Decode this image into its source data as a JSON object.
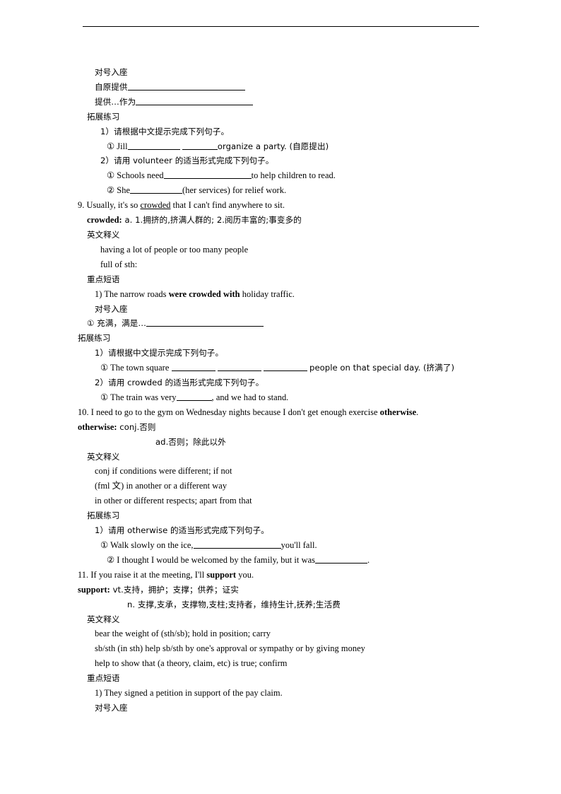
{
  "document": {
    "type": "english-vocabulary-worksheet",
    "header_rule": true,
    "lines": [
      {
        "id": "l1",
        "indent": 2,
        "script": "cn",
        "text": "对号入座"
      },
      {
        "id": "l2",
        "indent": 2,
        "script": "cn",
        "text": "① 自原提供",
        "blank": "xxl"
      },
      {
        "id": "l3",
        "indent": 2,
        "script": "cn",
        "text": "② 提供…作为",
        "blank": "xxl"
      },
      {
        "id": "l4",
        "indent": 1,
        "script": "cn",
        "text": "拓展练习"
      },
      {
        "id": "l5",
        "indent": 3,
        "script": "cn",
        "text": "1）请根据中文提示完成下列句子。"
      },
      {
        "id": "l6",
        "indent": 4,
        "script": "mixed",
        "text": "① Jill ________ ______organize a party. (自愿提出)"
      },
      {
        "id": "l7",
        "indent": 3,
        "script": "cn",
        "text": "2）请用 volunteer 的适当形式完成下列句子。"
      },
      {
        "id": "l8",
        "indent": 4,
        "script": "en",
        "text": "① Schools need ___________to help children to read."
      },
      {
        "id": "l9",
        "indent": 4,
        "script": "en",
        "text": "② She ________(her services) for relief work."
      },
      {
        "id": "l10",
        "indent": 0,
        "script": "en",
        "text": "9. Usually, it's so crowded that I can't find anywhere to sit."
      },
      {
        "id": "l11",
        "indent": 1,
        "script": "mixed",
        "text": "crowded: a. 1.拥挤的,挤满人群的; 2.阅历丰富的;事变多的"
      },
      {
        "id": "l12",
        "indent": 1,
        "script": "cn",
        "text": "英文释义"
      },
      {
        "id": "l13",
        "indent": 3,
        "script": "en",
        "text": "having a lot of people or too many people"
      },
      {
        "id": "l14",
        "indent": 3,
        "script": "en",
        "text": "full of sth:"
      },
      {
        "id": "l15",
        "indent": 1,
        "script": "cn",
        "text": "重点短语"
      },
      {
        "id": "l16",
        "indent": 2,
        "script": "en",
        "text": "1) The narrow roads were crowded with holiday traffic."
      },
      {
        "id": "l17",
        "indent": 2,
        "script": "cn",
        "text": "对号入座"
      },
      {
        "id": "l18",
        "indent": 1,
        "script": "cn",
        "text": "① 充满，满是…"
      },
      {
        "id": "l19",
        "indent": 0,
        "script": "cn",
        "text": "拓展练习"
      },
      {
        "id": "l20",
        "indent": 2,
        "script": "cn",
        "text": "1）请根据中文提示完成下列句子。"
      },
      {
        "id": "l21",
        "indent": 3,
        "script": "mixed",
        "text": "① The town square _____ _____ _____ people on that special day. (挤满了)"
      },
      {
        "id": "l22",
        "indent": 2,
        "script": "cn",
        "text": "2）请用 crowded 的适当形式完成下列句子。"
      },
      {
        "id": "l23",
        "indent": 3,
        "script": "en",
        "text": "① The train was very______, and we had to stand."
      },
      {
        "id": "l24",
        "indent": 0,
        "script": "en",
        "text": "10. I need to go to the gym on Wednesday nights because I don't get enough exercise otherwise."
      },
      {
        "id": "l25",
        "indent": 0,
        "script": "mixed",
        "text": "otherwise: conj.否则"
      },
      {
        "id": "l26",
        "indent": 8,
        "script": "cn",
        "text": "ad.否则；除此以外"
      },
      {
        "id": "l27",
        "indent": 1,
        "script": "cn",
        "text": "英文释义"
      },
      {
        "id": "l28",
        "indent": 2,
        "script": "en",
        "text": "conj if conditions were different; if not"
      },
      {
        "id": "l29",
        "indent": 2,
        "script": "mixed",
        "text": "(fml 文) in another or a different way"
      },
      {
        "id": "l30",
        "indent": 2,
        "script": "en",
        "text": "in other or different respects; apart from that"
      },
      {
        "id": "l31",
        "indent": 1,
        "script": "cn",
        "text": "拓展练习"
      },
      {
        "id": "l32",
        "indent": 2,
        "script": "cn",
        "text": "1）请用 otherwise 的适当形式完成下列句子。"
      },
      {
        "id": "l33",
        "indent": 3,
        "script": "en",
        "text": "① Walk slowly on the ice, ___________you'll fall."
      },
      {
        "id": "l34",
        "indent": 4,
        "script": "en",
        "text": "② I thought I would be welcomed by the family, but it was _________."
      },
      {
        "id": "l35",
        "indent": 0,
        "script": "en",
        "text": "11. If you raise it at the meeting, I'll support you."
      },
      {
        "id": "l36",
        "indent": 0,
        "script": "mixed",
        "text": "support: vt.支持，拥护；支撑；供养；证实"
      },
      {
        "id": "l37",
        "indent": 7,
        "script": "cn",
        "text": "n. 支撑,支承，支撑物,支柱;支持者，维持生计,抚养;生活费"
      },
      {
        "id": "l38",
        "indent": 1,
        "script": "cn",
        "text": "英文释义"
      },
      {
        "id": "l39",
        "indent": 2,
        "script": "en",
        "text": "bear the weight of (sth/sb); hold in position; carry"
      },
      {
        "id": "l40",
        "indent": 2,
        "script": "en",
        "text": "sb/sth (in sth) help sb/sth by one's approval or sympathy or by giving money"
      },
      {
        "id": "l41",
        "indent": 2,
        "script": "en",
        "text": "help to show that (a theory, claim, etc) is true; confirm"
      },
      {
        "id": "l42",
        "indent": 1,
        "script": "cn",
        "text": "重点短语"
      },
      {
        "id": "l43",
        "indent": 2,
        "script": "en",
        "text": "1) They signed a petition in support of the pay claim."
      },
      {
        "id": "l44",
        "indent": 2,
        "script": "cn",
        "text": "对号入座"
      }
    ],
    "text": {
      "dui_hao_ru_zuo": "对号入座",
      "tuo_zhan_lian_xi": "拓展练习",
      "ying_wen_shi_yi": "英文释义",
      "zhong_dian_duan_yu": "重点短语",
      "circle1": "①",
      "circle2": "②",
      "item1_ziyuan_tigong": "自原提供",
      "item2_tigong_zuowei": "提供…作为",
      "prompt_chinese_hint": "1）请根据中文提示完成下列句子。",
      "jill_sentence_pre": "① Jill",
      "jill_sentence_post": "organize a party. (自愿提出)",
      "prompt_volunteer_form": "2）请用 volunteer 的适当形式完成下列句子。",
      "schools_need_pre": "① Schools need",
      "schools_need_post": "to help children to read.",
      "she_pre": "② She",
      "she_post": "(her services) for relief work.",
      "sentence9": "9. Usually, it's so ",
      "sentence9_word": "crowded",
      "sentence9_rest": " that I can't find anywhere to sit.",
      "crowded_head": "crowded:",
      "crowded_defs": " a. 1.拥挤的,挤满人群的; 2.阅历丰富的;事变多的",
      "crowded_en1": "having a lot of people or too many people",
      "crowded_en2": "full of sth:",
      "crowded_phrase_num": "1) The narrow roads ",
      "crowded_phrase_bold": "were crowded with",
      "crowded_phrase_rest": " holiday traffic.",
      "chongman_manshi": "① 充满，满是…",
      "town_square_pre": "① The town square",
      "town_square_post": "people on that special day. (挤满了)",
      "prompt_crowded_form": "2）请用 crowded 的适当形式完成下列句子。",
      "train_pre": "① The train was very",
      "train_post": ", and we had to stand.",
      "sentence10_pre": "10. I need to go to the gym on Wednesday nights because I don't get enough exercise ",
      "sentence10_bold": "otherwise",
      "sentence10_post": ".",
      "otherwise_head": "otherwise:",
      "otherwise_conj": " conj.否则",
      "otherwise_ad": "ad.否则；除此以外",
      "otherwise_en1": "conj if conditions were different; if not",
      "otherwise_en2": "(fml 文) in another or a different way",
      "otherwise_en3": "in other or different respects; apart from that",
      "prompt_otherwise_form": "1）请用 otherwise 的适当形式完成下列句子。",
      "walk_pre": "① Walk slowly on the ice,",
      "walk_post": "you'll fall.",
      "thought_pre": "② I thought I would be welcomed by the family, but it was",
      "thought_post": ".",
      "sentence11_pre": "11. If you raise it at the meeting, I'll ",
      "sentence11_bold": "support",
      "sentence11_post": " you.",
      "support_head": "support:",
      "support_vt": " vt.支持，拥护；支撑；供养；证实",
      "support_n": "n. 支撑,支承，支撑物,支柱;支持者，维持生计,抚养;生活费",
      "support_en1": "bear the weight of (sth/sb); hold in position; carry",
      "support_en2": "sb/sth (in sth) help sb/sth by one's approval or sympathy or by giving money",
      "support_en3": "help to show that (a theory, claim, etc) is true; confirm",
      "support_phrase1": "1) They signed a petition in support of the pay claim."
    }
  }
}
